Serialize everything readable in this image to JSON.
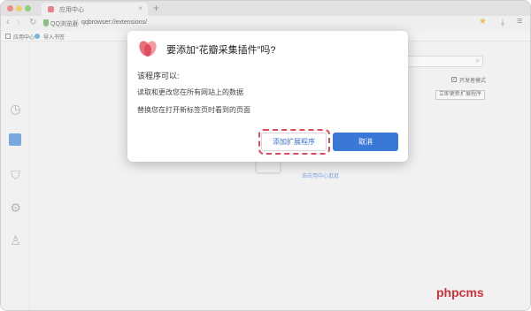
{
  "browser": {
    "tab_title": "应用中心",
    "tab_close": "×",
    "new_tab": "+",
    "address_brand": "QQ浏览器",
    "address_url": "qqbrowser://extensions/",
    "bookmarks": [
      "应用中心",
      "导入书签"
    ]
  },
  "page": {
    "developer_mode_label": "开发者模式",
    "developer_mode_checked": true,
    "update_button": "立即更新扩展程序",
    "store_link": "去应用中心逛逛",
    "sidebar_icons": [
      "clock-icon",
      "shopping-bag-icon",
      "shirt-icon",
      "gear-icon",
      "user-icon"
    ]
  },
  "dialog": {
    "title": "要添加“花瓣采集插件”吗?",
    "subtitle": "该程序可以:",
    "permissions": [
      "读取和更改您在所有网站上的数据",
      "替换您在打开新标签页时看到的页面"
    ],
    "add_button": "添加扩展程序",
    "cancel_button": "取消"
  },
  "colors": {
    "primary_button": "#3a78d8",
    "highlight": "#e04a5a",
    "accent_star": "#f0a500"
  },
  "watermark": "phpcms"
}
